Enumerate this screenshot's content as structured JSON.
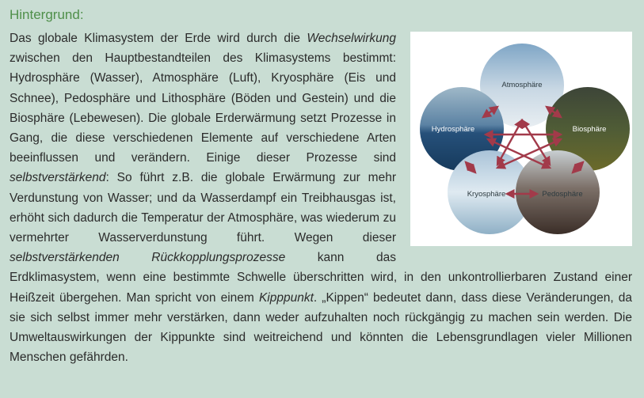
{
  "heading": "Hintergrund:",
  "paragraph": {
    "t1": "Das globale Klimasystem der Erde wird durch die ",
    "e1": "Wechselwirkung",
    "t2": " zwischen den Hauptbestandteilen des Klimasystems bestimmt: Hydrosphäre (Wasser), Atmosphäre (Luft), Kryosphäre (Eis und Schnee), Pedosphäre und Lithosphäre (Böden und Gestein) und die Biosphäre (Lebewesen). Die globale Erderwärmung setzt Prozesse in Gang, die diese verschiedenen Elemente auf verschiedene Arten beeinflussen und verändern. Einige dieser Prozesse sind ",
    "e2": "selbstverstärkend",
    "t3": ": So führt z.B. die globale Erwärmung zur mehr Verdunstung von Wasser; und da Wasserdampf ein Treibhausgas ist, erhöht sich dadurch die Temperatur der Atmosphäre, was wiederum zu vermehrter Wasserverdunstung führt. Wegen dieser ",
    "e3": "selbstverstärkenden Rückkopplungsprozesse",
    "t4": " kann das Erdklimasystem, wenn eine bestimmte Schwelle überschritten wird, in den unkontrollierbaren Zustand einer Heißzeit übergehen. Man spricht von einem ",
    "e4": "Kipppunkt",
    "t5": ". „Kippen“ bedeutet dann, dass diese Veränderungen, da sie sich selbst immer mehr verstärken, dann weder aufzuhalten noch rückgängig zu machen sein werden. Die Umweltauswirkungen der Kippunkte sind weitreichend und könnten die Lebensgrundlagen vieler Millionen Menschen gefährden."
  },
  "figure": {
    "labels": {
      "atmosphere": "Atmosphäre",
      "hydrosphere": "Hydrosphäre",
      "biosphere": "Biosphäre",
      "cryosphere": "Kryosphäre",
      "pedosphere": "Pedosphäre"
    },
    "arrow_color": "#a23a4a"
  }
}
